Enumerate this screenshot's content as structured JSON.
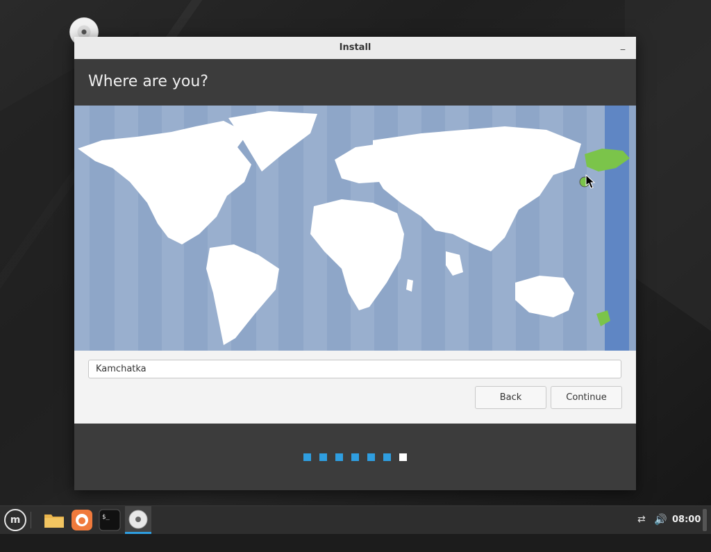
{
  "window": {
    "title": "Install",
    "minimize_glyph": "_"
  },
  "header": {
    "title": "Where are you?"
  },
  "map": {
    "selected_region": "Kamchatka",
    "ocean_color": "#8ea6c8",
    "land_color": "#ffffff",
    "highlight_color": "#7bc44a",
    "highlight_band_color": "#5f86c4"
  },
  "timezone_input": {
    "value": "Kamchatka"
  },
  "buttons": {
    "back": "Back",
    "continue": "Continue"
  },
  "progress": {
    "total_steps": 7,
    "current_step": 7,
    "active_color": "#2f9ee0"
  },
  "taskbar": {
    "menu_icon": "mint-logo-icon",
    "launchers": [
      "folder-icon",
      "firefox-icon",
      "terminal-icon",
      "disc-icon"
    ],
    "terminal_glyph": "$_",
    "clock": "08:00",
    "network_glyph": "⇄",
    "volume_glyph": "🔊"
  }
}
